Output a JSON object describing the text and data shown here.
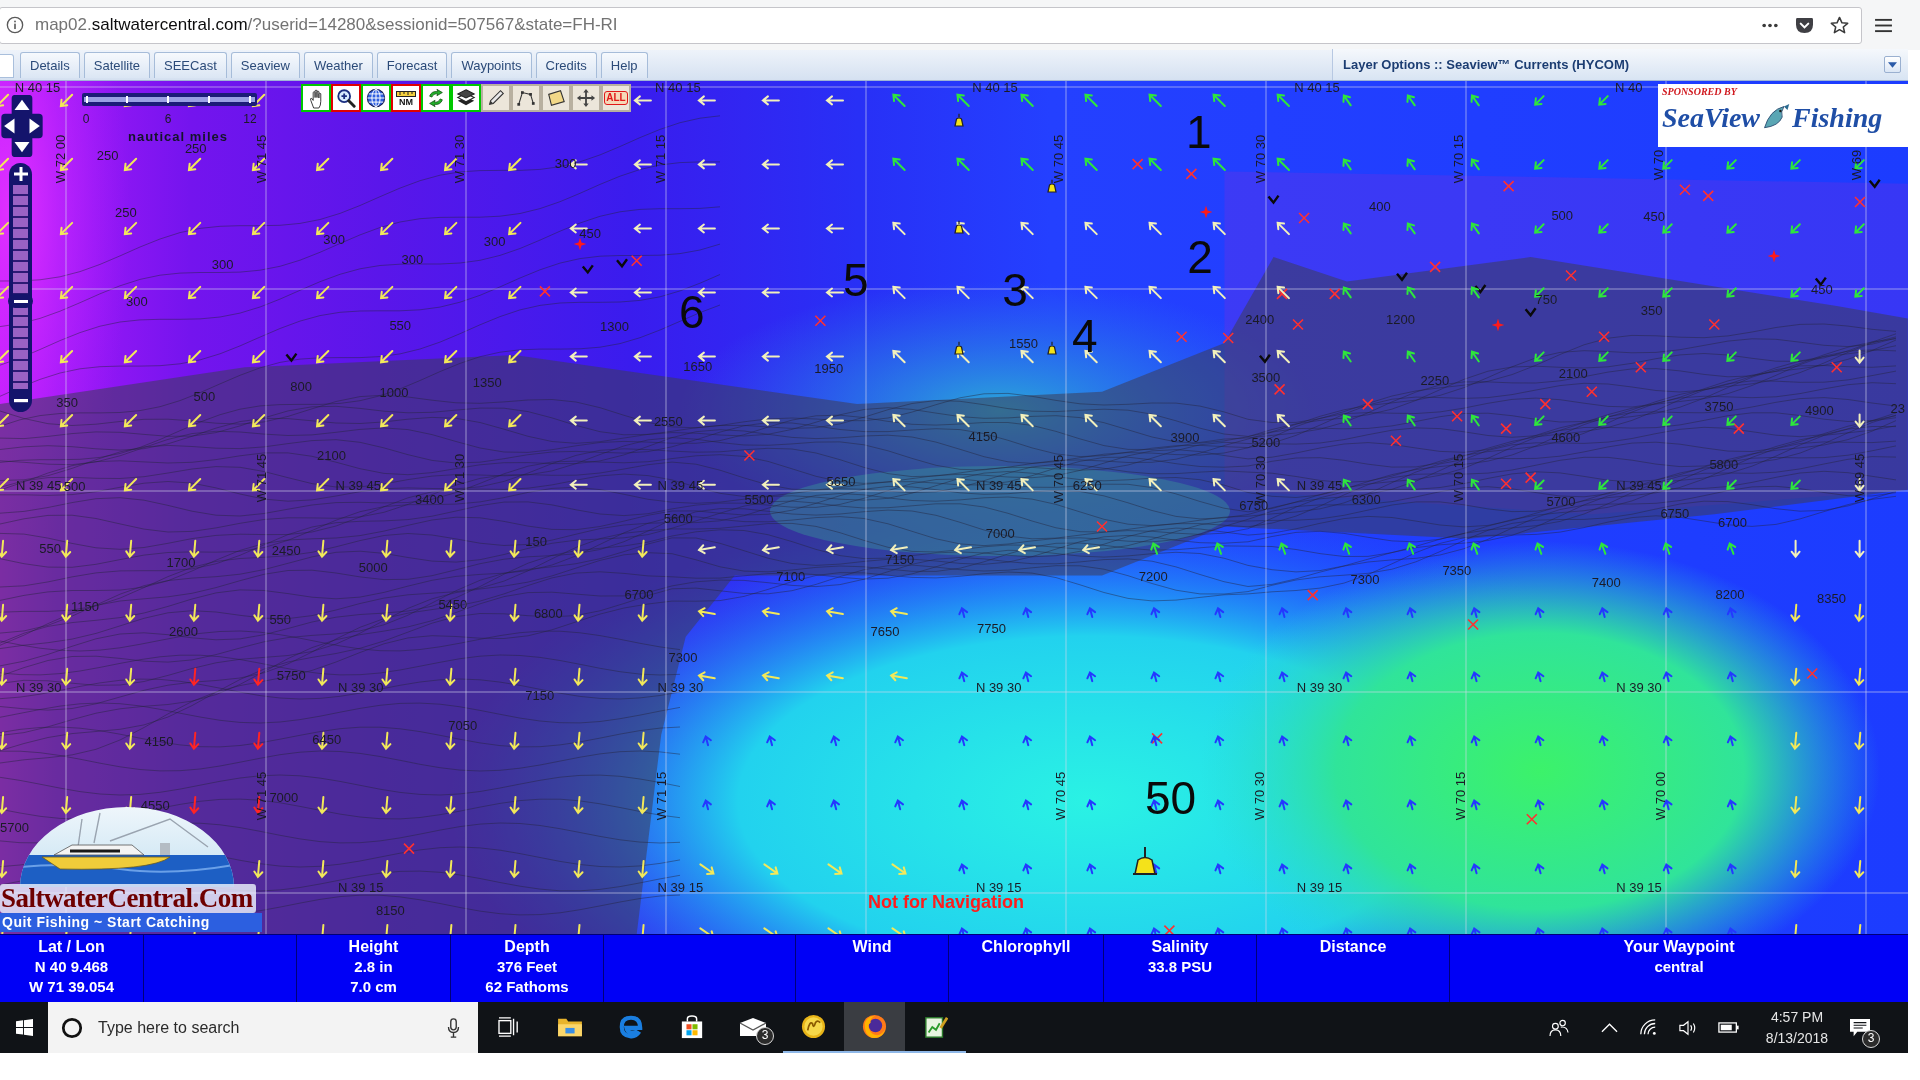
{
  "browser": {
    "url": {
      "prefix": "map02.",
      "domain": "saltwatercentral.com",
      "path": "/?userid=14280&sessionid=507567&state=FH-RI"
    }
  },
  "tabs": [
    {
      "label": "Details",
      "selected": false
    },
    {
      "label": "Satellite",
      "selected": false
    },
    {
      "label": "SEECast",
      "selected": false
    },
    {
      "label": "Seaview",
      "selected": false
    },
    {
      "label": "Weather",
      "selected": false
    },
    {
      "label": "Forecast",
      "selected": false
    },
    {
      "label": "Waypoints",
      "selected": false
    },
    {
      "label": "Credits",
      "selected": false
    },
    {
      "label": "Help",
      "selected": false
    }
  ],
  "layer_options": {
    "title": "Layer Options :: Seaview™ Currents (HYCOM)"
  },
  "map": {
    "tools": [
      {
        "kind": "hand",
        "color": "#00c800"
      },
      {
        "kind": "zoom",
        "color": "#e00000"
      },
      {
        "kind": "globe",
        "color": "#00c800"
      },
      {
        "kind": "scale",
        "label": "NM",
        "color": "#e00000"
      },
      {
        "kind": "refresh",
        "color": "#00c800"
      },
      {
        "kind": "layers",
        "color": "#00c800"
      },
      {
        "kind": "pencil"
      },
      {
        "kind": "polyline"
      },
      {
        "kind": "polygon"
      },
      {
        "kind": "move"
      },
      {
        "kind": "clear",
        "label": "ALL"
      }
    ],
    "scale": {
      "ticks": [
        "0",
        "6",
        "12"
      ],
      "unit": "nautical miles"
    },
    "zoom": {
      "level": 0.43
    },
    "lat_labels": [
      "N 40 15",
      "N 40 15",
      "N 40 15",
      "N 40 15",
      "N 40",
      "N 39 45",
      "N 39 45",
      "N 39 45",
      "N 39 45",
      "N 39 45",
      "N 39 45",
      "N 39 30",
      "N 39 30",
      "N 39 30",
      "N 39 30",
      "N 39 30",
      "N 39 30",
      "N 39 15",
      "N 39 15",
      "N 39 15",
      "N 39 15",
      "N 39 15"
    ],
    "lon_labels": [
      "W 72 00",
      "W 71 45",
      "W 71 30",
      "W 71 15",
      "W 70 45",
      "W 70 30",
      "W 70 15",
      "W 70",
      "W 69",
      "W 71 45",
      "W 71 30",
      "W 70 45",
      "W 70 30",
      "W 70 15",
      "W 69 45",
      "W 71 45",
      "W 71 15",
      "W 70 45",
      "W 70 30",
      "W 70 15",
      "W 70 00"
    ],
    "depth_labels": [
      "250",
      "250",
      "250",
      "300",
      "300",
      "500",
      "350",
      "300",
      "300",
      "300",
      "300",
      "450",
      "550",
      "800",
      "1000",
      "1350",
      "1300",
      "1650",
      "1950",
      "2550",
      "2100",
      "3400",
      "500",
      "550",
      "1700",
      "2450",
      "5000",
      "150",
      "1150",
      "550",
      "2600",
      "5450",
      "6800",
      "6700",
      "5750",
      "7150",
      "7300",
      "7050",
      "4150",
      "6450",
      "7000",
      "4550",
      "5700",
      "8150",
      "5500",
      "5600",
      "5650",
      "4150",
      "1550",
      "3900",
      "7000",
      "7150",
      "7100",
      "7650",
      "7750",
      "7200",
      "5200",
      "6750",
      "6300",
      "7300",
      "7350",
      "2400",
      "3500",
      "1200",
      "2250",
      "400",
      "500",
      "750",
      "2100",
      "4600",
      "5700",
      "3750",
      "4900",
      "5800",
      "6750",
      "6700",
      "7400",
      "8200",
      "8350",
      "450",
      "450",
      "350",
      "23",
      "6250"
    ],
    "waypoint_numbers": [
      "1",
      "2",
      "5",
      "3",
      "6",
      "4",
      "50"
    ],
    "notice": "Not for Navigation",
    "sponsor": {
      "caption": "SPONSORED BY",
      "brand": [
        "SeaView",
        "Fishing"
      ]
    },
    "logo": {
      "name": "SaltwaterCentral.Com",
      "slogan": "Quit Fishing ~ Start Catching"
    }
  },
  "info_bar": [
    {
      "heading": "Lat / Lon",
      "values": [
        "N 40 9.468",
        "W 71 39.054"
      ]
    },
    {
      "heading": "Height",
      "values": [
        "2.8 in",
        "7.0 cm"
      ]
    },
    {
      "heading": "Depth",
      "values": [
        "376 Feet",
        "62 Fathoms"
      ]
    },
    {
      "heading": "Wind"
    },
    {
      "heading": "Chlorophyll"
    },
    {
      "heading": "Salinity",
      "values": [
        "33.8 PSU"
      ]
    },
    {
      "heading": "Distance"
    },
    {
      "heading": "Your Waypoint",
      "values": [
        "central"
      ]
    }
  ],
  "taskbar": {
    "search": {
      "placeholder": "Type here to search"
    },
    "apps": [
      {
        "kind": "task_view",
        "running": false,
        "selected": false
      },
      {
        "kind": "folder",
        "running": false,
        "selected": false
      },
      {
        "kind": "browser_e",
        "running": false,
        "selected": false
      },
      {
        "kind": "store",
        "running": false,
        "selected": false
      },
      {
        "kind": "mail",
        "running": false,
        "selected": false,
        "badge": "3"
      },
      {
        "kind": "swirl",
        "running": true,
        "selected": false
      },
      {
        "kind": "firefox",
        "running": true,
        "selected": true
      },
      {
        "kind": "chart",
        "running": true,
        "selected": false
      }
    ],
    "time": "4:57 PM",
    "date": "8/13/2018",
    "notifications": "3"
  }
}
